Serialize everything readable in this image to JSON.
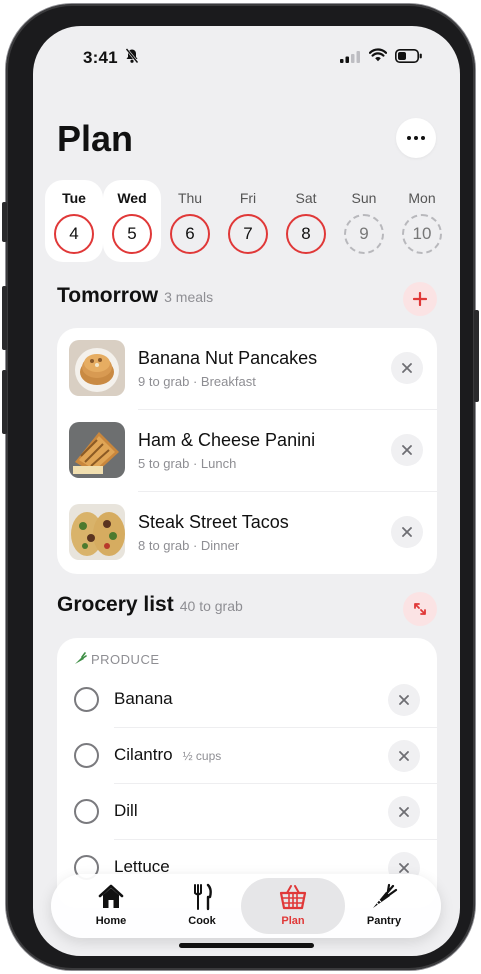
{
  "status": {
    "time": "3:41"
  },
  "page": {
    "title": "Plan"
  },
  "days": [
    {
      "name": "Tue",
      "num": "4"
    },
    {
      "name": "Wed",
      "num": "5"
    },
    {
      "name": "Thu",
      "num": "6"
    },
    {
      "name": "Fri",
      "num": "7"
    },
    {
      "name": "Sat",
      "num": "8"
    },
    {
      "name": "Sun",
      "num": "9"
    },
    {
      "name": "Mon",
      "num": "10"
    }
  ],
  "tomorrow": {
    "title": "Tomorrow",
    "count": "3 meals",
    "meals": [
      {
        "name": "Banana Nut Pancakes",
        "grab": "9 to grab",
        "type": "· Breakfast"
      },
      {
        "name": "Ham & Cheese Panini",
        "grab": "5 to grab",
        "type": "· Lunch"
      },
      {
        "name": "Steak Street Tacos",
        "grab": "8 to grab",
        "type": "· Dinner"
      }
    ]
  },
  "grocery": {
    "title": "Grocery list",
    "count": "40 to grab",
    "section": "PRODUCE",
    "items": [
      {
        "name": "Banana",
        "qty": ""
      },
      {
        "name": "Cilantro",
        "qty": "½ cups"
      },
      {
        "name": "Dill",
        "qty": ""
      },
      {
        "name": "Lettuce",
        "qty": ""
      }
    ]
  },
  "tabs": [
    {
      "label": "Home",
      "icon": "house-icon"
    },
    {
      "label": "Cook",
      "icon": "fork-knife-icon"
    },
    {
      "label": "Plan",
      "icon": "basket-icon"
    },
    {
      "label": "Pantry",
      "icon": "carrot-icon"
    }
  ],
  "colors": {
    "accent": "#e03838",
    "accent_soft": "#fbe3e4",
    "background": "#efeff1"
  }
}
